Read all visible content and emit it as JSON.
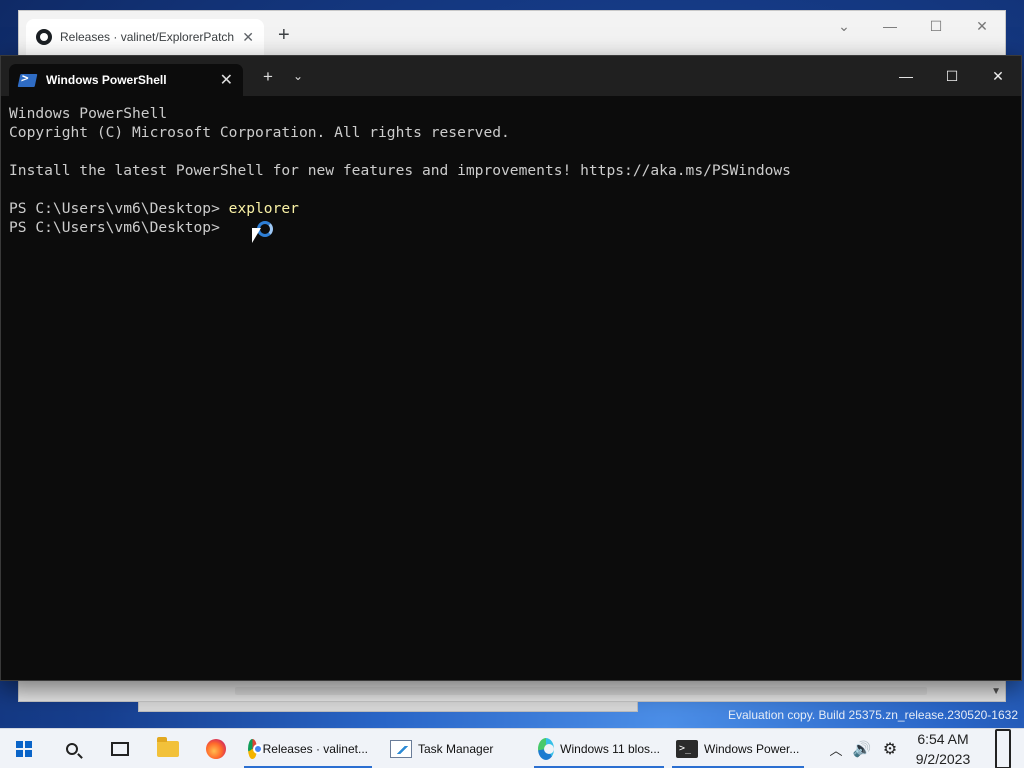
{
  "browser": {
    "tab_title": "Releases · valinet/ExplorerPatcher",
    "new_tab_label": "+",
    "controls": {
      "dropdown": "⌄",
      "minimize": "—",
      "maximize": "☐",
      "close": "✕"
    }
  },
  "terminal": {
    "tab_title": "Windows PowerShell",
    "tab_close": "✕",
    "new_tab": "+",
    "dropdown": "⌄",
    "controls": {
      "minimize": "—",
      "maximize": "☐",
      "close": "✕"
    },
    "lines": [
      "Windows PowerShell",
      "Copyright (C) Microsoft Corporation. All rights reserved.",
      "",
      "Install the latest PowerShell for new features and improvements! https://aka.ms/PSWindows",
      "",
      "PS C:\\Users\\vm6\\Desktop> ",
      "PS C:\\Users\\vm6\\Desktop> "
    ],
    "command": "explorer"
  },
  "desktop": {
    "watermark": "Evaluation copy. Build 25375.zn_release.230520-1632"
  },
  "taskbar": {
    "apps": [
      {
        "label": "Releases · valinet...",
        "icon": "chrome-icon",
        "active": true
      },
      {
        "label": "Task Manager",
        "icon": "task-manager-icon",
        "active": false
      },
      {
        "label": "Windows 11 blos...",
        "icon": "edge-icon",
        "active": true
      },
      {
        "label": "Windows Power...",
        "icon": "terminal-icon",
        "active": true
      }
    ],
    "tray": {
      "chevron": "︿",
      "volume": "🔊",
      "settings": "⚙"
    },
    "clock": {
      "time": "6:54 AM",
      "date": "9/2/2023"
    }
  },
  "colors": {
    "terminal_bg": "#0c0c0c",
    "terminal_fg": "#cccccc",
    "command_yellow": "#f9f1a5",
    "accent": "#2b6fd1"
  }
}
